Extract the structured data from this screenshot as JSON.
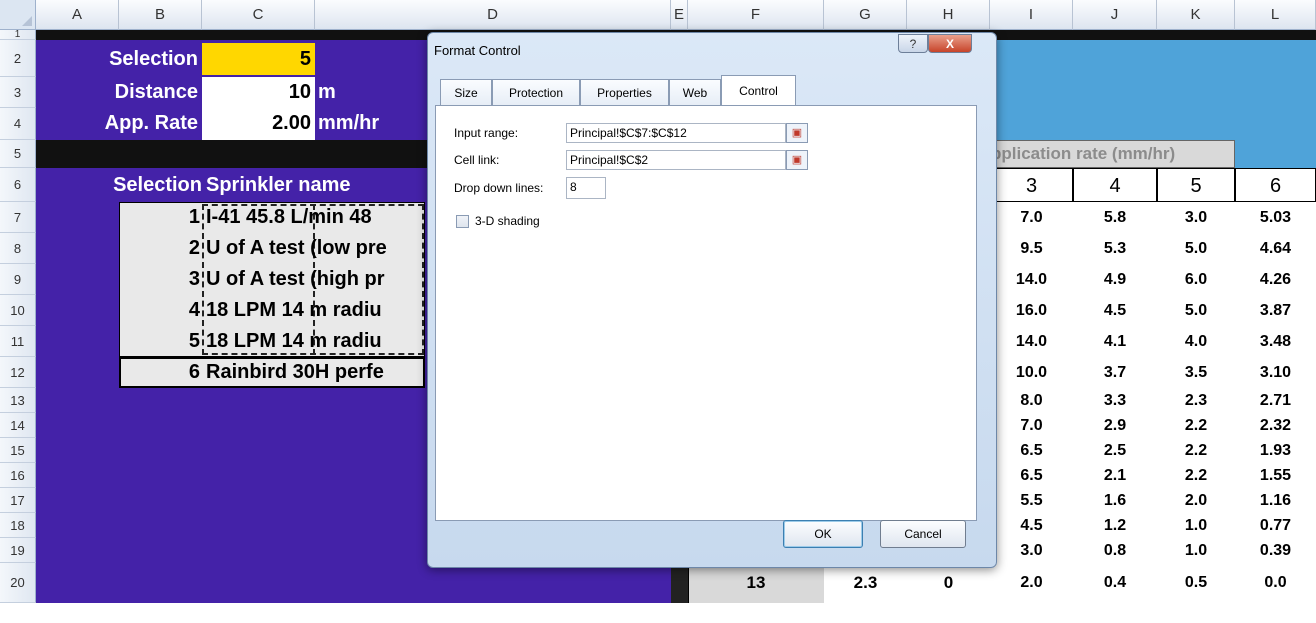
{
  "columns": [
    "A",
    "B",
    "C",
    "D",
    "E",
    "F",
    "G",
    "H",
    "I",
    "J",
    "K",
    "L"
  ],
  "rows": [
    "1",
    "2",
    "3",
    "4",
    "5",
    "6",
    "7",
    "8",
    "9",
    "10",
    "11",
    "12",
    "13",
    "14",
    "15",
    "16",
    "17",
    "18",
    "19",
    "20"
  ],
  "controls": {
    "selection_label": "Selection",
    "selection_value": "5",
    "distance_label": "Distance",
    "distance_value": "10",
    "distance_unit": "m",
    "rate_label": "App. Rate",
    "rate_value": "2.00",
    "rate_unit": "mm/hr"
  },
  "table": {
    "header_selection": "Selection",
    "header_name": "Sprinkler name",
    "rows": [
      {
        "n": "1",
        "name": "I-41  45.8 L/min  48"
      },
      {
        "n": "2",
        "name": "U of A test (low pre"
      },
      {
        "n": "3",
        "name": "U of A test (high pr"
      },
      {
        "n": "4",
        "name": "18 LPM 14 m radiu"
      },
      {
        "n": "5",
        "name": "18 LPM 14 m radiu"
      },
      {
        "n": "6",
        "name": "Rainbird 30H perfe"
      }
    ]
  },
  "right": {
    "app_rate_header": "pplication rate (mm/hr)",
    "col_headers": [
      "3",
      "4",
      "5",
      "6"
    ],
    "rows": [
      [
        "7.0",
        "5.8",
        "3.0",
        "5.03"
      ],
      [
        "9.5",
        "5.3",
        "5.0",
        "4.64"
      ],
      [
        "14.0",
        "4.9",
        "6.0",
        "4.26"
      ],
      [
        "16.0",
        "4.5",
        "5.0",
        "3.87"
      ],
      [
        "14.0",
        "4.1",
        "4.0",
        "3.48"
      ],
      [
        "10.0",
        "3.7",
        "3.5",
        "3.10"
      ],
      [
        "8.0",
        "3.3",
        "2.3",
        "2.71"
      ],
      [
        "7.0",
        "2.9",
        "2.2",
        "2.32"
      ],
      [
        "6.5",
        "2.5",
        "2.2",
        "1.93"
      ],
      [
        "6.5",
        "2.1",
        "2.2",
        "1.55"
      ],
      [
        "5.5",
        "1.6",
        "2.0",
        "1.16"
      ],
      [
        "4.5",
        "1.2",
        "1.0",
        "0.77"
      ],
      [
        "3.0",
        "0.8",
        "1.0",
        "0.39"
      ],
      [
        "2.0",
        "0.4",
        "0.5",
        "0.0"
      ]
    ],
    "row20": {
      "f": "13",
      "g": "2.3",
      "h": "0"
    }
  },
  "dialog": {
    "title": "Format Control",
    "help": "?",
    "close": "X",
    "tabs": [
      "Size",
      "Protection",
      "Properties",
      "Web",
      "Control"
    ],
    "input_range_label": "Input range:",
    "input_range_value": "Principal!$C$7:$C$12",
    "cell_link_label": "Cell link:",
    "cell_link_value": "Principal!$C$2",
    "drop_down_label": "Drop down lines:",
    "drop_down_value": "8",
    "shading_label": "3-D shading",
    "ok": "OK",
    "cancel": "Cancel"
  },
  "colors": {
    "purple": "#4422a8",
    "blue": "#4fa3d9",
    "yellow": "#ffd700"
  }
}
